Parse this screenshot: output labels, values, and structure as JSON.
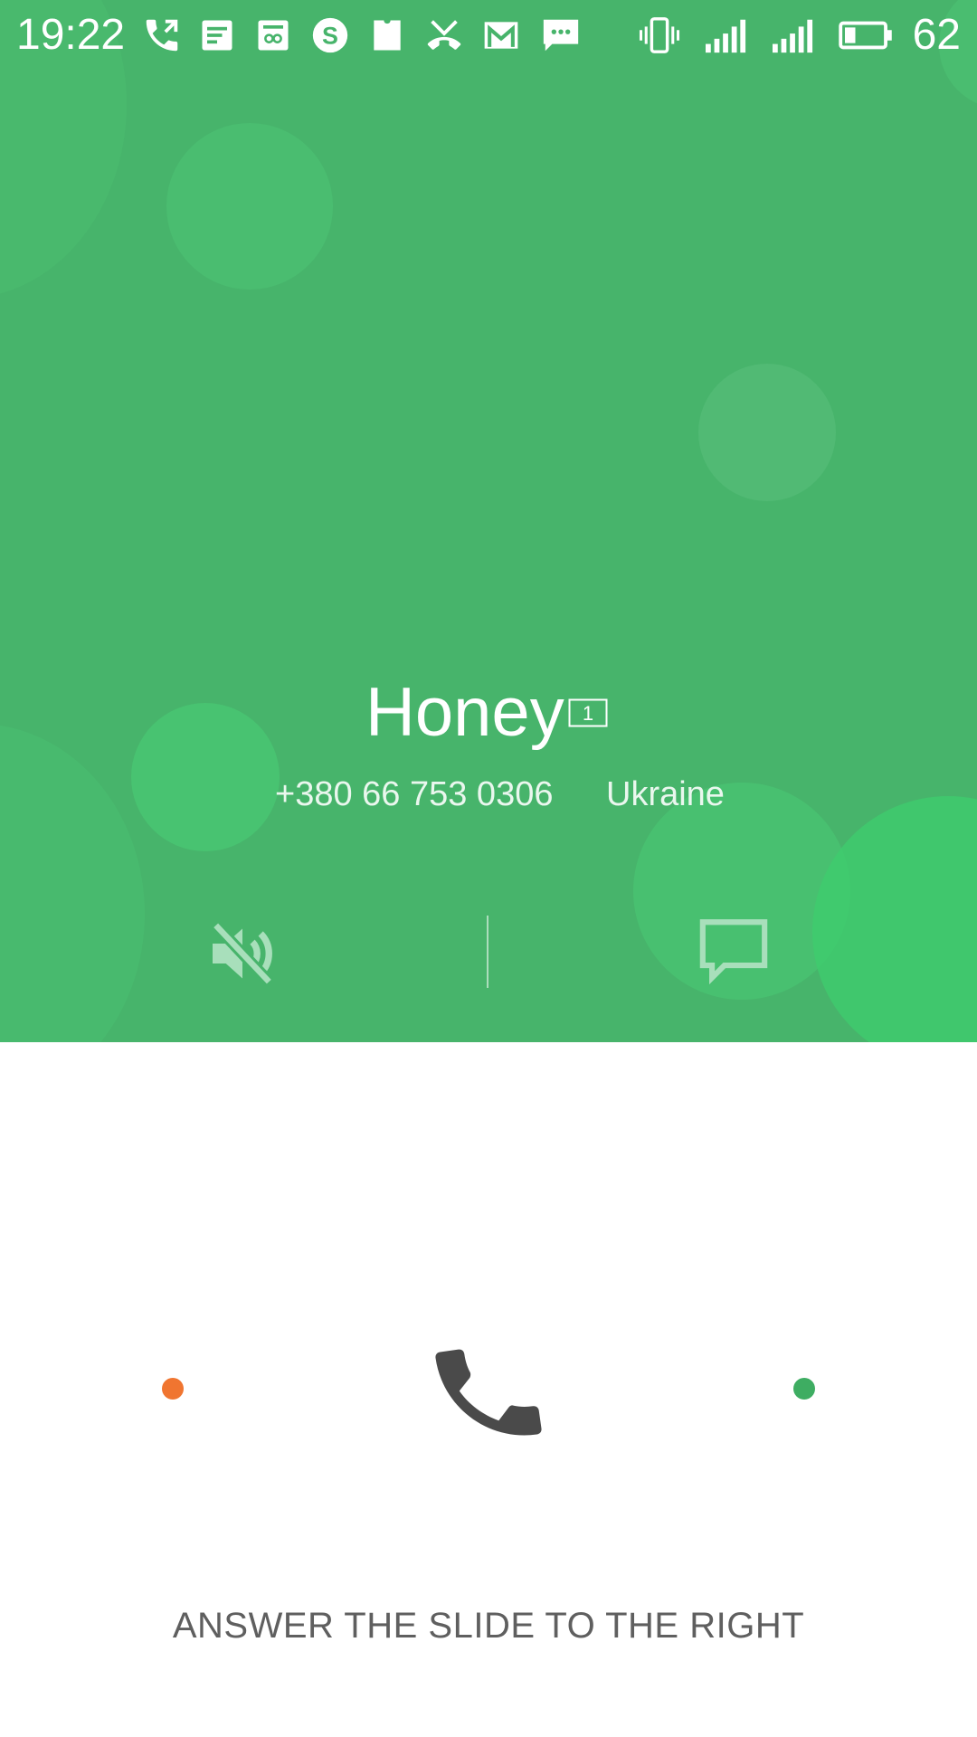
{
  "status_bar": {
    "time": "19:22",
    "battery_percent": "62",
    "notification_icons": [
      "call-forwarded-icon",
      "document-icon",
      "spreadsheet-icon",
      "skype-icon",
      "sd-card-icon",
      "missed-call-icon",
      "gmail-icon",
      "message-icon"
    ],
    "system_icons": [
      "vibrate-icon",
      "signal-sim1-icon",
      "signal-sim2-icon",
      "battery-icon"
    ]
  },
  "caller": {
    "name": "Honey",
    "sim_slot": "1",
    "number": "+380 66 753 0306",
    "country": "Ukraine"
  },
  "actions": {
    "mute_icon": "speaker-muted-icon",
    "message_icon": "message-bubble-icon"
  },
  "answer": {
    "handle_icon": "phone-handset-icon",
    "hint": "ANSWER THE SLIDE TO THE RIGHT"
  },
  "colors": {
    "background_green": "#47b46b",
    "decline_dot": "#f07530",
    "answer_dot": "#3ead62",
    "handset": "#4a4a4a",
    "hint_text": "#5f5f5f"
  }
}
